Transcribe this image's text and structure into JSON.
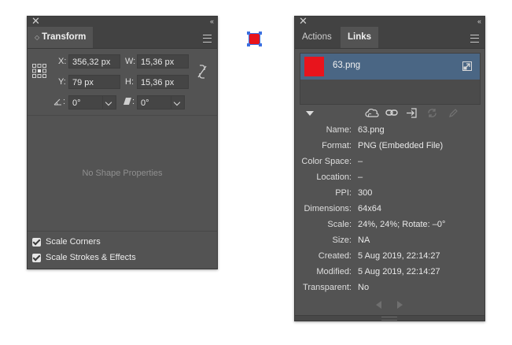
{
  "transform_panel": {
    "title": "Transform",
    "x_label": "X:",
    "x_value": "356,32 px",
    "y_label": "Y:",
    "y_value": "79 px",
    "w_label": "W:",
    "w_value": "15,36 px",
    "h_label": "H:",
    "h_value": "15,36 px",
    "rotate_suffix": ":",
    "rotate_value": "0°",
    "shear_suffix": ":",
    "shear_value": "0°",
    "empty_text": "No Shape Properties",
    "scale_corners": "Scale Corners",
    "scale_strokes": "Scale Strokes & Effects"
  },
  "links_panel": {
    "tabs": [
      "Actions",
      "Links"
    ],
    "active_tab": "Links",
    "file_name": "63.png",
    "thumbnail_color": "#e8141c",
    "info": [
      {
        "key": "Name:",
        "value": "63.png"
      },
      {
        "key": "Format:",
        "value": "PNG (Embedded File)"
      },
      {
        "key": "Color Space:",
        "value": "–"
      },
      {
        "key": "Location:",
        "value": "–"
      },
      {
        "key": "PPI:",
        "value": "300"
      },
      {
        "key": "Dimensions:",
        "value": "64x64"
      },
      {
        "key": "Scale:",
        "value": "24%, 24%; Rotate: –0°"
      },
      {
        "key": "Size:",
        "value": "NA"
      },
      {
        "key": "Created:",
        "value": "5 Aug 2019, 22:14:27"
      },
      {
        "key": "Modified:",
        "value": "5 Aug 2019, 22:14:27"
      },
      {
        "key": "Transparent:",
        "value": "No"
      }
    ]
  },
  "canvas": {
    "selected_object_color": "#e8141c",
    "selection_color": "#3b6fe0"
  },
  "colors": {
    "panel_bg": "#535353",
    "header_bg": "#424242",
    "selected_row": "#4a6684"
  }
}
